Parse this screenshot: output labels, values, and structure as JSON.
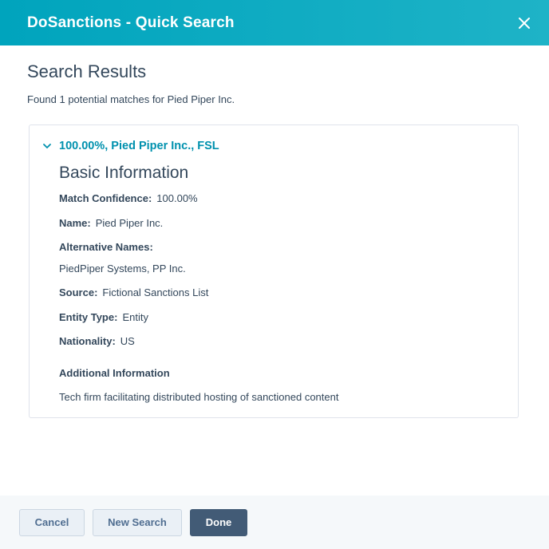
{
  "header": {
    "title": "DoSanctions - Quick Search",
    "close_icon": "close-icon"
  },
  "main": {
    "title": "Search Results",
    "summary": "Found 1 potential matches for Pied Piper Inc."
  },
  "result": {
    "label": "100.00%, Pied Piper Inc., FSL",
    "expanded": true,
    "section_title": "Basic Information",
    "match_confidence_label": "Match Confidence:",
    "match_confidence_value": "100.00%",
    "name_label": "Name:",
    "name_value": "Pied Piper Inc.",
    "alt_names_label": "Alternative Names:",
    "alt_names_value": "PiedPiper Systems, PP Inc.",
    "source_label": "Source:",
    "source_value": "Fictional Sanctions List",
    "entity_type_label": "Entity Type:",
    "entity_type_value": "Entity",
    "nationality_label": "Nationality:",
    "nationality_value": "US",
    "additional_label": "Additional Information",
    "additional_value": "Tech firm facilitating distributed hosting of sanctioned content"
  },
  "footer": {
    "cancel_label": "Cancel",
    "new_search_label": "New Search",
    "done_label": "Done"
  },
  "colors": {
    "header_start": "#00a4bd",
    "header_end": "#1eb3c7",
    "link": "#0091ae",
    "text": "#33475b",
    "primary_button": "#425b76",
    "secondary_button": "#eaf0f6",
    "footer_bg": "#f5f8fa"
  }
}
